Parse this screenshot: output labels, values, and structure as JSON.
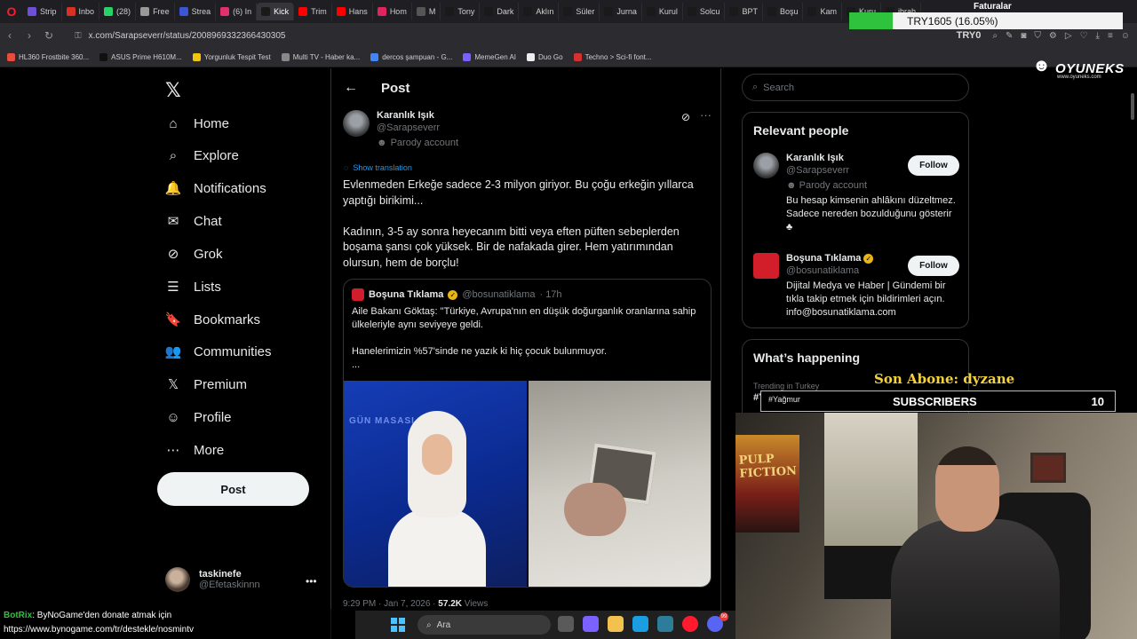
{
  "browser": {
    "tabs": [
      {
        "label": "Strip",
        "color": "#6e4fd6"
      },
      {
        "label": "Inbo",
        "color": "#d93025"
      },
      {
        "label": "(28)",
        "color": "#25d366"
      },
      {
        "label": "Free",
        "color": "#999999"
      },
      {
        "label": "Strea",
        "color": "#3a56d4"
      },
      {
        "label": "(6) In",
        "color": "#e1306c"
      },
      {
        "label": "Kick",
        "color": "#1a1a1a",
        "active": true
      },
      {
        "label": "Trim",
        "color": "#ff0000"
      },
      {
        "label": "Hans",
        "color": "#ff0000"
      },
      {
        "label": "Hom",
        "color": "#e0245e"
      },
      {
        "label": "M",
        "color": "#555555"
      },
      {
        "label": "Tony",
        "color": "#1a1a1a"
      },
      {
        "label": "Dark",
        "color": "#1a1a1a"
      },
      {
        "label": "Aklın",
        "color": "#1a1a1a"
      },
      {
        "label": "Süler",
        "color": "#1a1a1a"
      },
      {
        "label": "Jurna",
        "color": "#1a1a1a"
      },
      {
        "label": "Kurul",
        "color": "#1a1a1a"
      },
      {
        "label": "Solcu",
        "color": "#1a1a1a"
      },
      {
        "label": "BPT",
        "color": "#1a1a1a"
      },
      {
        "label": "Boşu",
        "color": "#1a1a1a"
      },
      {
        "label": "Kam",
        "color": "#1a1a1a"
      },
      {
        "label": "Kuru",
        "color": "#1a1a1a"
      },
      {
        "label": "ibrah",
        "color": "#1a1a1a"
      }
    ],
    "url": "x.com/Sarapseverr/status/2008969332366430305",
    "try_label": "TRY0",
    "bookmarks": [
      {
        "label": "HL360 Frostbite 360...",
        "color": "#e74c3c"
      },
      {
        "label": "ASUS Prime H610M...",
        "color": "#111111"
      },
      {
        "label": "Yorgunluk Tespit Test",
        "color": "#f1c40f"
      },
      {
        "label": "Multi TV - Haber ka...",
        "color": "#888888"
      },
      {
        "label": "dercos şampuan - G...",
        "color": "#4285f4"
      },
      {
        "label": "MemeGen AI",
        "color": "#7d5fff"
      },
      {
        "label": "Duo Go",
        "color": "#eeeeee"
      },
      {
        "label": "Techno > Sci-fi font...",
        "color": "#d63031"
      }
    ]
  },
  "nav": {
    "items": [
      {
        "label": "Home",
        "icon": "home-icon"
      },
      {
        "label": "Explore",
        "icon": "search-icon"
      },
      {
        "label": "Notifications",
        "icon": "bell-icon"
      },
      {
        "label": "Chat",
        "icon": "mail-icon"
      },
      {
        "label": "Grok",
        "icon": "grok-icon"
      },
      {
        "label": "Lists",
        "icon": "list-icon"
      },
      {
        "label": "Bookmarks",
        "icon": "bookmark-icon"
      },
      {
        "label": "Communities",
        "icon": "people-icon"
      },
      {
        "label": "Premium",
        "icon": "x-icon"
      },
      {
        "label": "Profile",
        "icon": "user-icon"
      },
      {
        "label": "More",
        "icon": "more-icon"
      }
    ],
    "post_button": "Post",
    "account": {
      "name": "taskinefe",
      "handle": "@Efetaskinnn"
    }
  },
  "post": {
    "header_title": "Post",
    "author_name": "Karanlık Işık",
    "author_handle": "@Sarapseverr",
    "parody_label": "Parody account",
    "show_translation": "Show translation",
    "text": "Evlenmeden Erkeğe sadece 2-3 milyon giriyor. Bu çoğu erkeğin yıllarca yaptığı birikimi...\n\nKadının, 3-5 ay sonra heyecanım bitti veya eften püften sebeplerden boşama şansı çok yüksek. Bir de nafakada girer. Hem yatırımından olursun, hem de borçlu!",
    "quote": {
      "name": "Boşuna Tıklama",
      "handle": "@bosunatiklama",
      "time": "· 17h",
      "text": "Aile Bakanı Göktaş: \"Türkiye, Avrupa'nın en düşük doğurganlık oranlarına sahip ülkeleriyle aynı seviyeye geldi.\n\nHanelerimizin %57'sinde ne yazık ki hiç çocuk bulunmuyor.\n...",
      "tv_text": "GÜN MASASI"
    },
    "time": "9:29 PM · Jan 7, 2026 ·",
    "views_count": "57.2K",
    "views_label": "Views"
  },
  "sidebar": {
    "search_placeholder": "Search",
    "relevant_title": "Relevant people",
    "people": [
      {
        "name": "Karanlık Işık",
        "handle": "@Sarapseverr",
        "parody": "Parody account",
        "bio": "Bu hesap kimsenin ahlâkını düzeltmez. Sadece nereden bozulduğunu gösterir ♣",
        "follow": "Follow"
      },
      {
        "name": "Boşuna Tıklama",
        "handle": "@bosunatiklama",
        "bio": "Dijital Medya ve Haber | Gündemi bir tıkla takip etmek için bildirimleri açın. info@bosunatiklama.com",
        "follow": "Follow"
      }
    ],
    "happening_title": "What’s happening",
    "trend_label": "Trending in Turkey",
    "trend_name": "#Yağmur"
  },
  "overlay": {
    "xp_top_label": "Faturalar",
    "xp_text": "TRY1605 (16.05%)",
    "xp_progress": 0.1605,
    "sponsor_name": "OYUNEKS",
    "sponsor_url": "www.oyuneks.com",
    "last_sub": "Son Abone: dyzane",
    "subscribers_label": "SUBSCRIBERS",
    "subscribers_count": "10",
    "trending_mini": "#Yağmur",
    "poster_title": "PULP FICTION",
    "chat_bot": "BotRix",
    "chat_message": ": ByNoGame'den donate atmak için",
    "chat_link": "https://www.bynogame.com/tr/destekle/nosmintv",
    "taskbar_search": "Ara"
  }
}
